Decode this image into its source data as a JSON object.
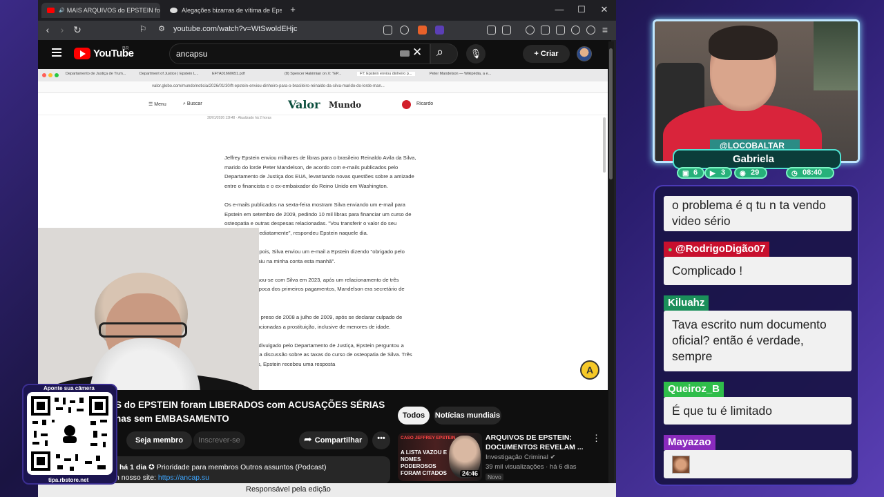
{
  "browser": {
    "tabs": [
      {
        "title": "MAIS ARQUIVOS do EPSTEIN foram",
        "active": true
      },
      {
        "title": "Alegações bizarras de vítima de Epstein - Gr",
        "active": false
      }
    ],
    "new_tab": "+",
    "url": "youtube.com/watch?v=WtSwoldEHjc",
    "window_controls": {
      "minimize": "—",
      "maximize": "☐",
      "close": "✕"
    }
  },
  "youtube": {
    "logo_text": "YouTube",
    "country": "BR",
    "search_value": "ancapsu",
    "create_label": "Criar",
    "video_title": "S do EPSTEIN foram LIBERADOS com ACUSAÇÕES SÉRIAS nas sem EMBASAMENTO",
    "join_label": "Seja membro",
    "subscribe_label": "Inscrever-se",
    "share_label": "Compartilhar",
    "more_label": "•••",
    "description": {
      "line1_time": "há 1 dia",
      "line1_rest": "✪ Prioridade para membros  Outros assuntos  (Podcast)",
      "line2_prefix": "n nosso site: ",
      "line2_link": "https://ancap.su"
    },
    "filter_chips": [
      "Todos",
      "Notícias mundiais"
    ],
    "recommended": {
      "thumb_caption": "CASO JEFFREY EPSTEIN",
      "thumb_text": "A LISTA VAZOU E NOMES PODEROSOS FORAM CITADOS",
      "duration": "24:46",
      "title": "ARQUIVOS DE EPSTEIN: DOCUMENTOS REVELAM ...",
      "channel": "Investigação Criminal",
      "views": "39 mil visualizações · há 6 dias",
      "badge": "Novo"
    },
    "status_bar": "Responsável pela edição"
  },
  "inner_browser": {
    "tabs": [
      "Departamento de Justiça de Trum...",
      "Department of Justice | Epstein L...",
      "EFTA01660651.pdf",
      "(8) Spencer Hakimian on X: \"EP...",
      "FT: Epstein enviou dinheiro p...",
      "Peter Mandelson — Wikipédia, a e..."
    ],
    "url": "valor.globo.com/mundo/noticia/2026/01/30/ft-epstein-enviou-dinheiro-para-o-brasileiro-reinaldo-da-silva-marido-do-lorde-man..."
  },
  "valor": {
    "menu": "Menu",
    "search": "Buscar",
    "logo": "Valor",
    "section": "Mundo",
    "user": "Ricardo",
    "date": "30/01/2026 13h48 · Atualizado há 2 horas",
    "paragraphs": [
      "Jeffrey Epstein enviou milhares de libras para o brasileiro Reinaldo Avila da Silva, marido do lorde Peter Mandelson, de acordo com e-mails publicados pelo Departamento de Justiça dos EUA, levantando novas questões sobre a amizade entre o financista e o ex-embaixador do Reino Unido em Washington.",
      "Os e-mails publicados na sexta-feira mostram Silva enviando um e-mail para Epstein em setembro de 2009, pedindo 10 mil libras para financiar um curso de osteopatia e outras despesas relacionadas. \"Vou transferir o valor do seu empréstimo imediatamente\", respondeu Epstein naquele dia.",
      "Alguns dias depois, Silva enviou um e-mail a Epstein dizendo \"obrigado pelo dinheiro que caiu na minha conta esta manhã\".",
      "Mandelson casou-se com Silva em 2023, após um relacionamento de três décadas. Na época dos primeiros pagamentos, Mandelson era secretário de Negócios.",
      "Epstein esteve preso de 2008 a julho de 2009, após se declarar culpado de acusações relacionadas a prostituição, inclusive de menores de idade.",
      "Em um e-mail divulgado pelo Departamento de Justiça, Epstein perguntou a Mandelson uma discussão sobre as taxas do curso de osteopatia de Silva. Três minutos depois, Epstein recebeu uma resposta"
    ]
  },
  "qr": {
    "top_label": "Aponte sua câmera",
    "bottom_label": "tipa.rbstore.net"
  },
  "stream": {
    "handle": "@LOCOBALTAR",
    "name": "Gabriela",
    "stats": [
      {
        "icon": "chat-icon",
        "value": "6"
      },
      {
        "icon": "youtube-icon",
        "value": "3"
      },
      {
        "icon": "twitch-icon",
        "value": "29"
      },
      {
        "icon": "clock-icon",
        "value": "08:40"
      }
    ]
  },
  "chat": [
    {
      "user": "",
      "text": "o problema é q tu n ta vendo video sério"
    },
    {
      "user": "@RodrigoDigão07",
      "text": "Complicado !",
      "color": "#c8102e"
    },
    {
      "user": "Kiluahz",
      "text": "Tava escrito num documento oficial? então é verdade, sempre",
      "color": "#1a8f5a"
    },
    {
      "user": "Queiroz_B",
      "text": "É que tu é limitado",
      "color": "#2fbd4a"
    },
    {
      "user": "Mayazao",
      "text": "",
      "color": "#8a2bbd"
    }
  ]
}
